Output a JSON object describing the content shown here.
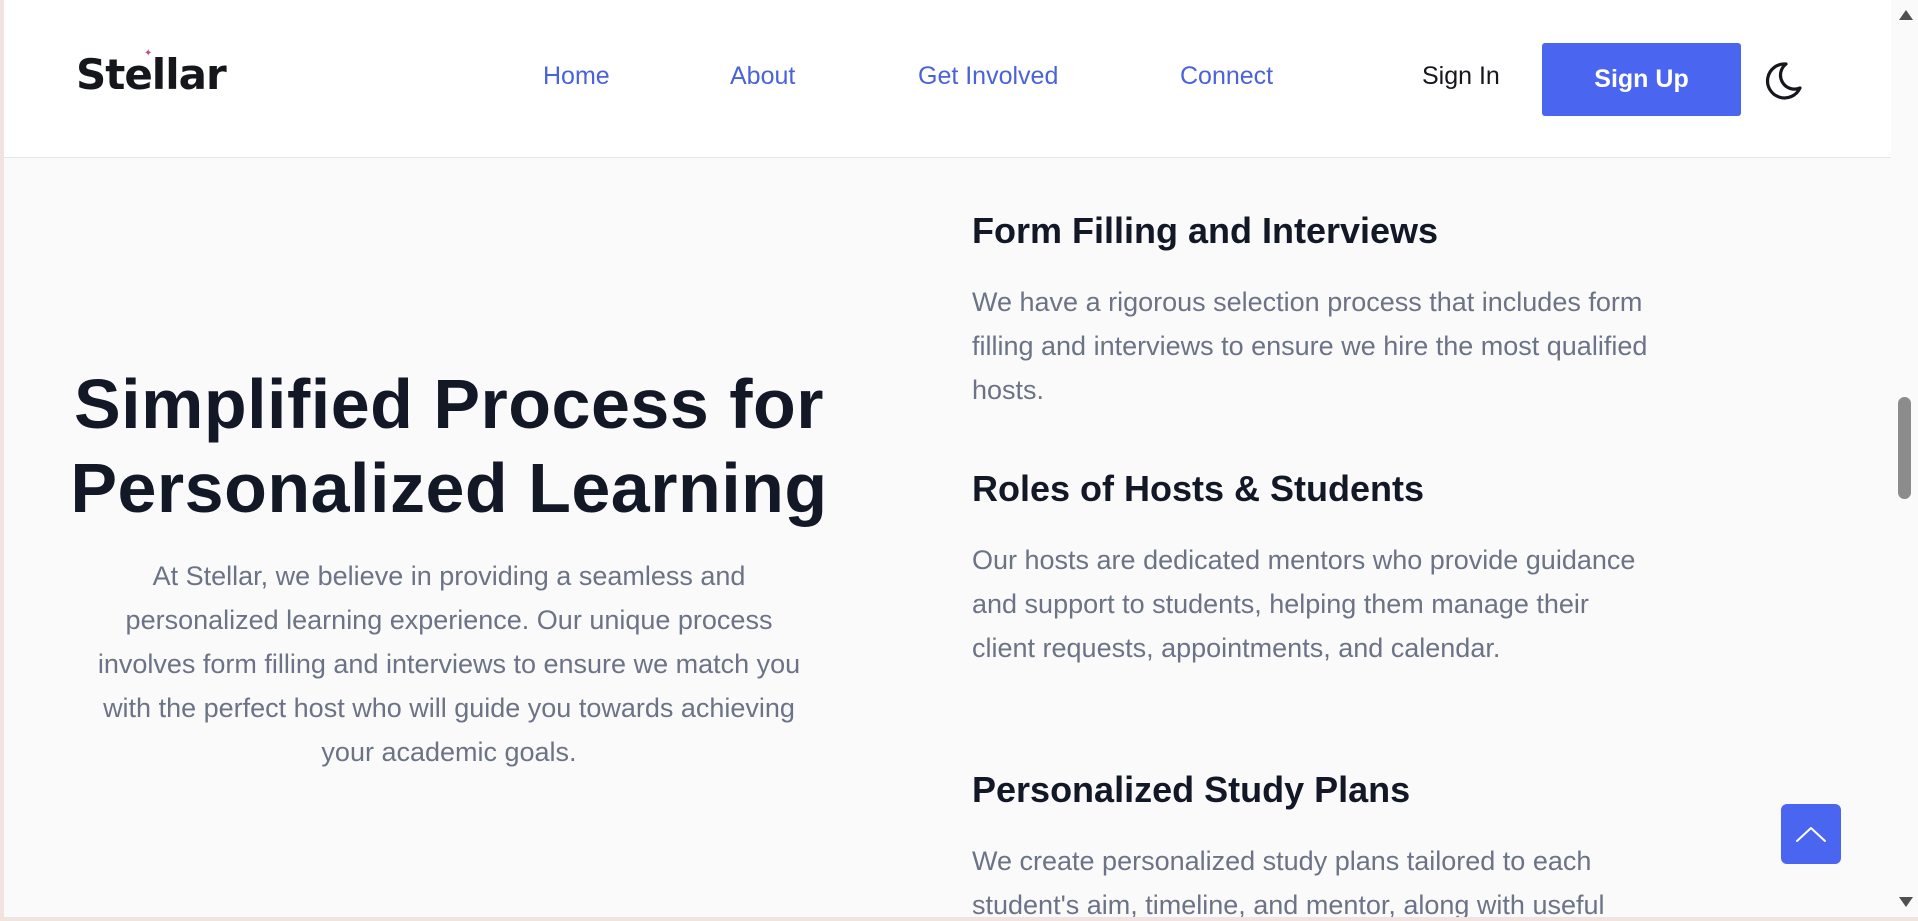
{
  "header": {
    "logo": "Stellar",
    "nav": [
      "Home",
      "About",
      "Get Involved",
      "Connect"
    ],
    "sign_in": "Sign In",
    "sign_up": "Sign Up"
  },
  "hero": {
    "title_line1": "Simplified Process for",
    "title_line2": "Personalized Learning",
    "description": "At Stellar, we believe in providing a seamless and personalized learning experience. Our unique process involves form filling and interviews to ensure we match you with the perfect host who will guide you towards achieving your academic goals."
  },
  "features": [
    {
      "title": "Form Filling and Interviews",
      "text": "We have a rigorous selection process that includes form filling and interviews to ensure we hire the most qualified hosts."
    },
    {
      "title": "Roles of Hosts & Students",
      "text": "Our hosts are dedicated mentors who provide guidance and support to students, helping them manage their client requests, appointments, and calendar."
    },
    {
      "title": "Personalized Study Plans",
      "text": "We create personalized study plans tailored to each student's aim, timeline, and mentor, along with useful"
    }
  ],
  "colors": {
    "accent": "#4a65f0",
    "nav_link": "#4a63d9",
    "heading": "#121826",
    "body_text": "#6b7386"
  },
  "icons": [
    "moon-icon",
    "chevron-up-icon"
  ]
}
